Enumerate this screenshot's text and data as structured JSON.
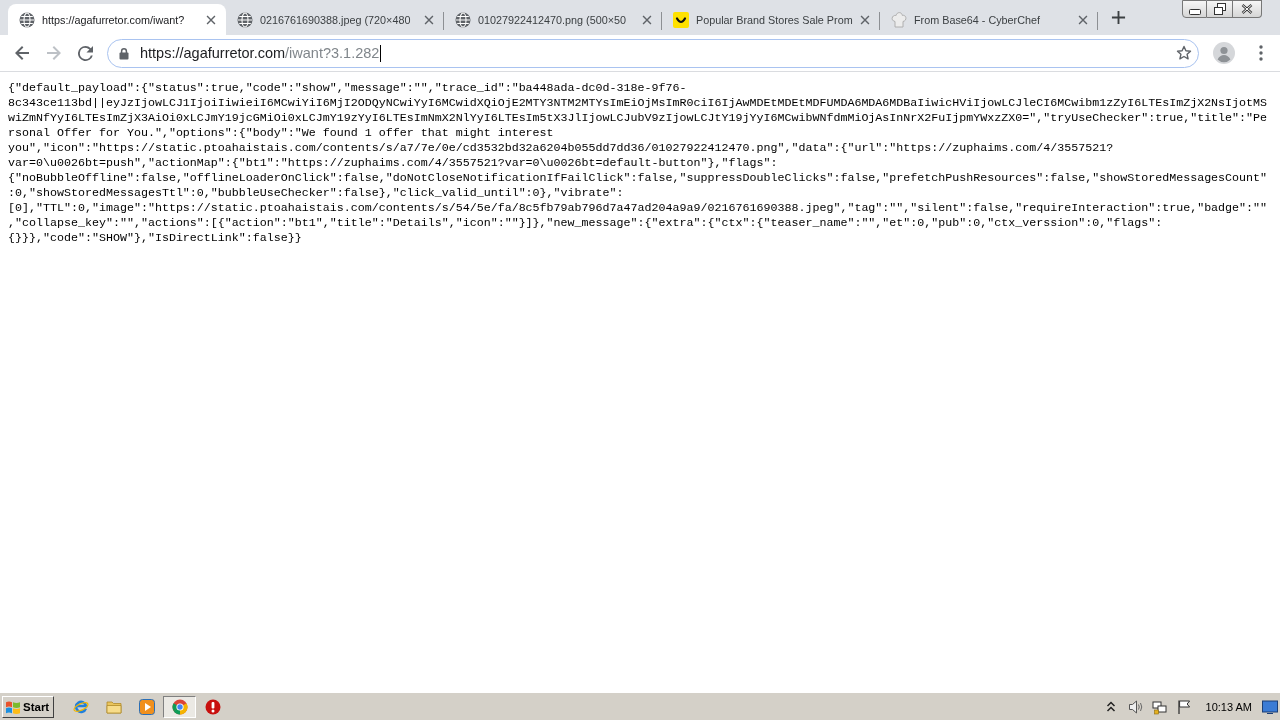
{
  "tabs": [
    {
      "title": "https://agafurretor.com/iwant?",
      "kind": "globe",
      "selected": true
    },
    {
      "title": "0216761690388.jpeg (720×480",
      "kind": "globe",
      "selected": false
    },
    {
      "title": "01027922412470.png (500×50",
      "kind": "globe",
      "selected": false
    },
    {
      "title": "Popular Brand Stores Sale Prom",
      "kind": "smiley",
      "selected": false
    },
    {
      "title": "From Base64 - CyberChef",
      "kind": "chefhat",
      "selected": false
    }
  ],
  "toolbar": {
    "back": {
      "disabled": false
    },
    "forward": {
      "disabled": true
    }
  },
  "address_bar": {
    "host": "https://agafurretor.com",
    "path": "/iwant?3.1.282"
  },
  "page": {
    "text": "{\"default_payload\":{\"status\":true,\"code\":\"show\",\"message\":\"\",\"trace_id\":\"ba448ada-dc0d-318e-9f76-8c343ce113bd||eyJzIjowLCJ1IjoiIiwieiI6MCwiYiI6MjI2ODQyNCwiYyI6MCwidXQiOjE2MTY3NTM2MTYsImEiOjMsImR0ciI6IjAwMDEtMDEtMDFUMDA6MDA6MDBaIiwicHViIjowLCJleCI6MCwibm1zZyI6LTEsImZjX2NsIjotMSwiZmNfYyI6LTEsImZjX3AiOi0xLCJmY19jcGMiOi0xLCJmY19zYyI6LTEsImNmX2NlYyI6LTEsIm5tX3JlIjowLCJubV9zIjowLCJtY19jYyI6MCwibWNfdmMiOjAsInNrX2FuIjpmYWxzZX0=\",\"tryUseChecker\":true,\"title\":\"Personal Offer for You.\",\"options\":{\"body\":\"We found 1 offer that might interest you\",\"icon\":\"https://static.ptoahaistais.com/contents/s/a7/7e/0e/cd3532bd32a6204b055dd7dd36/01027922412470.png\",\"data\":{\"url\":\"https://zuphaims.com/4/3557521?var=0\\u0026bt=push\",\"actionMap\":{\"bt1\":\"https://zuphaims.com/4/3557521?var=0\\u0026bt=default-button\"},\"flags\":{\"noBubbleOffline\":false,\"offlineLoaderOnClick\":false,\"doNotCloseNotificationIfFailClick\":false,\"suppressDoubleClicks\":false,\"prefetchPushResources\":false,\"showStoredMessagesCount\":0,\"showStoredMessagesTtl\":0,\"bubbleUseChecker\":false},\"click_valid_until\":0},\"vibrate\":[0],\"TTL\":0,\"image\":\"https://static.ptoahaistais.com/contents/s/54/5e/fa/8c5fb79ab796d7a47ad204a9a9/0216761690388.jpeg\",\"tag\":\"\",\"silent\":false,\"requireInteraction\":true,\"badge\":\"\",\"collapse_key\":\"\",\"actions\":[{\"action\":\"bt1\",\"title\":\"Details\",\"icon\":\"\"}]},\"new_message\":{\"extra\":{\"ctx\":{\"teaser_name\":\"\",\"et\":0,\"pub\":0,\"ctx_verssion\":0,\"flags\":{}}},\"code\":\"SHOW\"},\"IsDirectLink\":false}}"
  },
  "taskbar": {
    "start_label": "Start",
    "apps": [
      {
        "kind": "ie",
        "selected": false
      },
      {
        "kind": "folder",
        "selected": false
      },
      {
        "kind": "player",
        "selected": false
      },
      {
        "kind": "chrome",
        "selected": true
      },
      {
        "kind": "stop",
        "selected": false
      }
    ],
    "clock": "10:13 AM"
  }
}
